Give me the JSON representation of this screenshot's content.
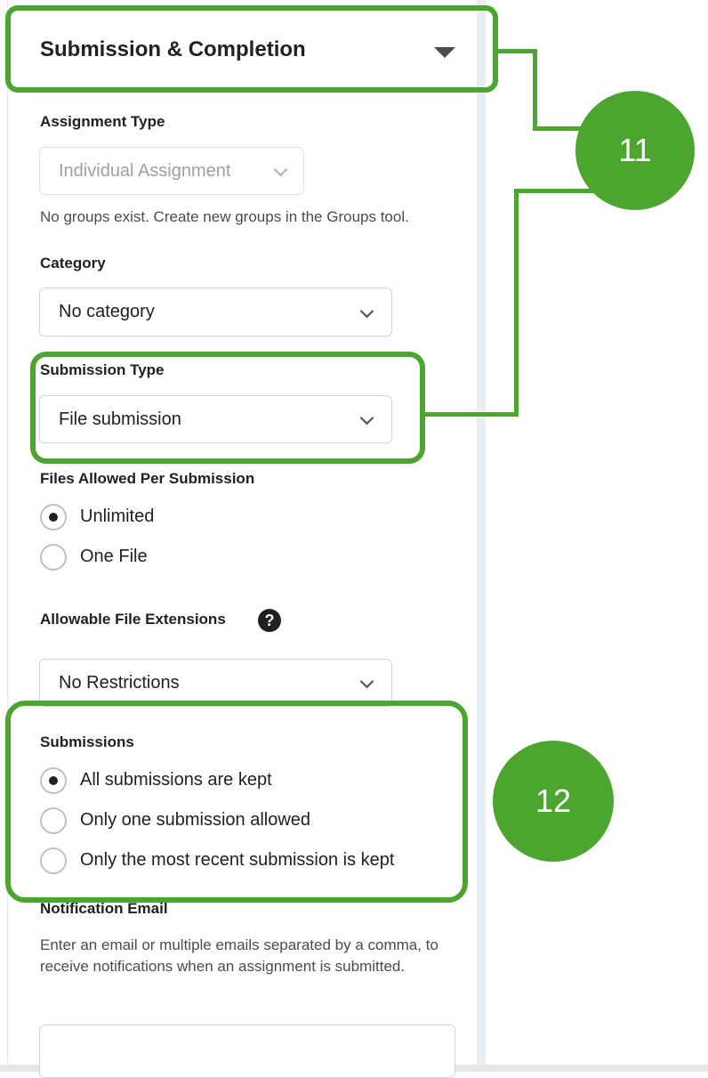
{
  "section": {
    "title": "Submission & Completion"
  },
  "assignment_type": {
    "label": "Assignment Type",
    "value": "Individual Assignment",
    "help": "No groups exist. Create new groups in the Groups tool."
  },
  "category": {
    "label": "Category",
    "value": "No category"
  },
  "submission_type": {
    "label": "Submission Type",
    "value": "File submission"
  },
  "files_allowed": {
    "label": "Files Allowed Per Submission",
    "options": [
      {
        "label": "Unlimited",
        "checked": true
      },
      {
        "label": "One File",
        "checked": false
      }
    ]
  },
  "extensions": {
    "label": "Allowable File Extensions",
    "help_icon": "question-circle-icon",
    "value": "No Restrictions"
  },
  "submissions": {
    "label": "Submissions",
    "options": [
      {
        "label": "All submissions are kept",
        "checked": true
      },
      {
        "label": "Only one submission allowed",
        "checked": false
      },
      {
        "label": "Only the most recent submission is kept",
        "checked": false
      }
    ]
  },
  "notification": {
    "label": "Notification Email",
    "help": "Enter an email or multiple emails separated by a comma, to receive notifications when an assignment is submitted.",
    "value": ""
  },
  "callouts": [
    {
      "number": "11"
    },
    {
      "number": "12"
    }
  ],
  "colors": {
    "callout_green": "#4ca52f",
    "text": "#202122"
  }
}
